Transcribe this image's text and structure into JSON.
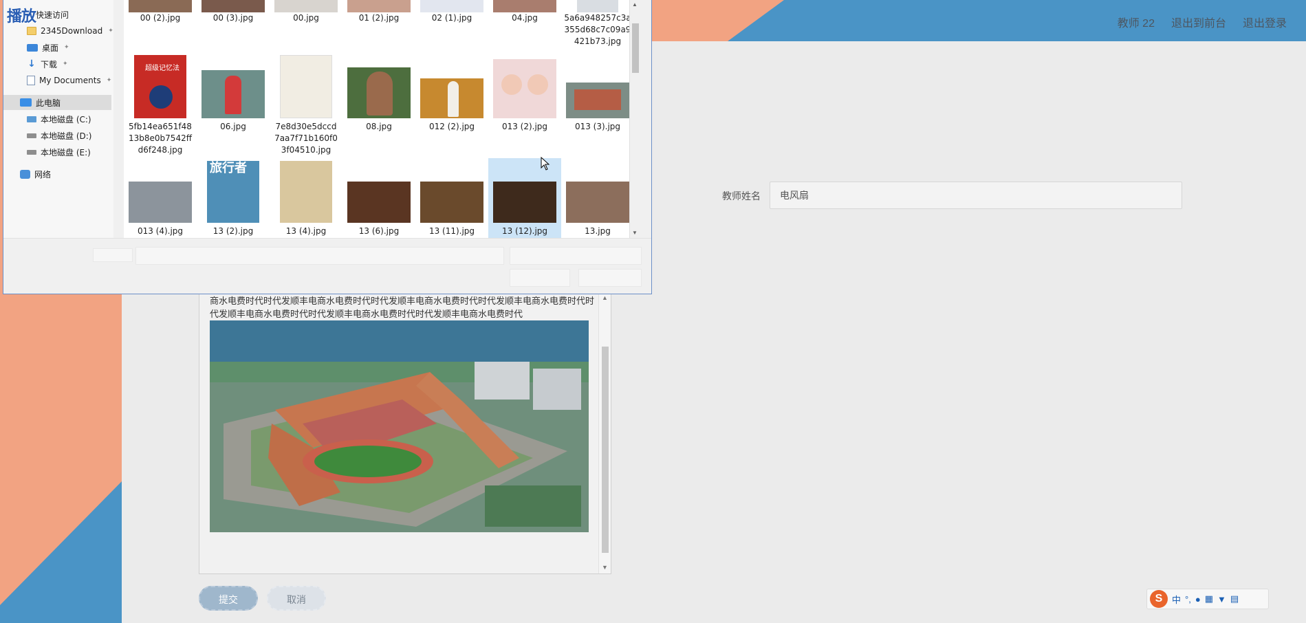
{
  "header": {
    "nav": [
      "教师 22",
      "退出到前台",
      "退出登录"
    ]
  },
  "form": {
    "teacher_name_label": "教师姓名",
    "teacher_name_value": "电风扇",
    "editor_text": "商水电费时代时代发顺丰电商水电费时代时代发顺丰电商水电费时代时代发顺丰电商水电费时代时代发顺丰电商水电费时代时代发顺丰电商水电费时代时代发顺丰电商水电费时代",
    "submit_label": "提交",
    "cancel_label": "取消"
  },
  "ime": {
    "logo": "S",
    "mode": "中",
    "punct": "°,"
  },
  "dialog": {
    "overlay_logo": "播放",
    "nav": {
      "quick_access": "快速访问",
      "items": [
        "2345Download",
        "桌面",
        "下载",
        "My Documents"
      ],
      "this_pc": "此电脑",
      "drives": [
        "本地磁盘 (C:)",
        "本地磁盘 (D:)",
        "本地磁盘 (E:)"
      ],
      "network": "网络"
    },
    "files_row1": [
      "00 (2).jpg",
      "00 (3).jpg",
      "00.jpg",
      "01 (2).jpg",
      "02 (1).jpg",
      "04.jpg",
      "5a6a948257c3a355d68c7c09a9421b73.jpg"
    ],
    "files_row2": [
      "5fb14ea651f4813b8e0b7542ffd6f248.jpg",
      "06.jpg",
      "7e8d30e5dccd7aa7f71b160f03f04510.jpg",
      "08.jpg",
      "012 (2).jpg",
      "013 (2).jpg",
      "013 (3).jpg"
    ],
    "files_row3": [
      "013 (4).jpg",
      "13 (2).jpg",
      "13 (4).jpg",
      "13 (6).jpg",
      "13 (11).jpg",
      "13 (12).jpg",
      "13.jpg"
    ],
    "thumb_texts": {
      "book1": "超级记忆法",
      "magazine": "旅行者"
    }
  },
  "colors": {
    "accent_blue": "#4a94c6",
    "accent_orange": "#f2a382",
    "selected_file": "#cce4f7"
  }
}
